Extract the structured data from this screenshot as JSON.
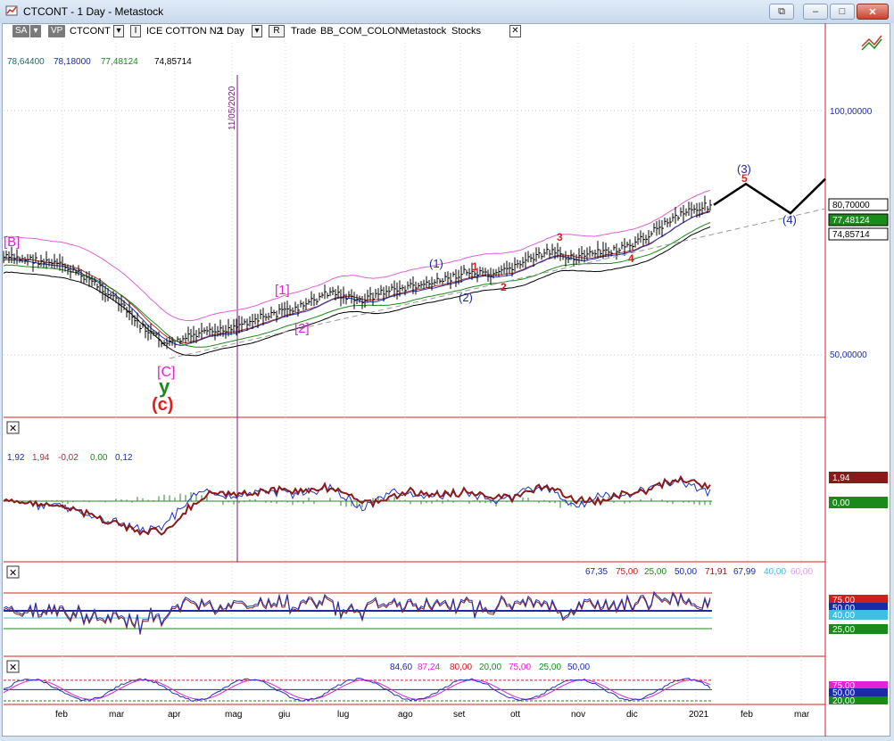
{
  "window": {
    "title": "CTCONT - 1 Day - Metastock",
    "buttons": {
      "restore_a": "⧉",
      "min": "–",
      "max": "□",
      "close": "✕"
    }
  },
  "toolbar": {
    "sa": "SA",
    "vp": "VP",
    "symbol": "CTCONT",
    "sym_dropdown": "▾",
    "i_box": "I",
    "instrument": "ICE COTTON N2",
    "period": "1 Day",
    "period_dropdown": "▾",
    "r_box": "R",
    "trade": "Trade",
    "layout": "BB_COM_COLON",
    "metastock": "Metastock",
    "stocks": "Stocks",
    "close": "✕"
  },
  "colors": {
    "price_bars": "#000000",
    "wave_magenta": "#e023d6",
    "wave_blue": "#1c2aa8",
    "wave_red": "#e02020",
    "wave_green": "#1a8a1a",
    "ma_blue": "#2233bb",
    "ma_red": "#b03030",
    "ma_green": "#1a8a1a",
    "panel_border": "#cc2020",
    "vline": "#7a1a7a"
  },
  "main_panel": {
    "header_values": [
      {
        "text": "78,64400",
        "color": "#1a6a6a"
      },
      {
        "text": "78,18000",
        "color": "#1c2aa8"
      },
      {
        "text": "77,48124",
        "color": "#1a8a1a"
      },
      {
        "text": "74,85714",
        "color": "#000000"
      }
    ],
    "y_ticks": [
      "100,00000",
      "50,00000"
    ],
    "date_marker": "11/05/2020",
    "price_labels": [
      {
        "text": "80,70000",
        "bg": "#ffffff",
        "fg": "#000000"
      },
      {
        "text": "77,48124",
        "bg": "#1a8a1a",
        "fg": "#ffffff"
      },
      {
        "text": "74,85714",
        "bg": "#ffffff",
        "fg": "#000000"
      }
    ],
    "wave_labels": [
      "[B]",
      "[C]",
      "y",
      "(c)",
      "[1]",
      "[2]",
      "(1)",
      "(2)",
      "1",
      "2",
      "3",
      "4",
      "(3)",
      "5",
      "(4)"
    ],
    "panel_close": "✕"
  },
  "macd_panel": {
    "values": [
      {
        "text": "1,92",
        "color": "#1c2aa8"
      },
      {
        "text": "1,94",
        "color": "#b03030"
      },
      {
        "text": "-0,02",
        "color": "#b03030"
      },
      {
        "text": "0,00",
        "color": "#1a8a1a"
      },
      {
        "text": "0,12",
        "color": "#1c2aa8"
      }
    ],
    "right_labels": [
      {
        "text": "1,94",
        "bg": "#8a1a1a",
        "fg": "#ffffff"
      },
      {
        "text": "0,00",
        "bg": "#1a8a1a",
        "fg": "#ffffff"
      }
    ],
    "panel_close": "✕"
  },
  "rsi_panel": {
    "values": [
      {
        "text": "67,35",
        "color": "#1c2aa8"
      },
      {
        "text": "75,00",
        "color": "#cc2020"
      },
      {
        "text": "25,00",
        "color": "#1a8a1a"
      },
      {
        "text": "50,00",
        "color": "#1c2aa8"
      },
      {
        "text": "71,91",
        "color": "#8a1a1a"
      },
      {
        "text": "67,99",
        "color": "#1c2aa8"
      },
      {
        "text": "40,00",
        "color": "#40c0e0"
      },
      {
        "text": "60,00",
        "color": "#e0a0e0"
      }
    ],
    "right_labels": [
      {
        "text": "75,00",
        "bg": "#cc2020",
        "fg": "#ffffff"
      },
      {
        "text": "50,00",
        "bg": "#1c2aa8",
        "fg": "#ffffff"
      },
      {
        "text": "40,00",
        "bg": "#40c0e0",
        "fg": "#ffffff"
      },
      {
        "text": "25,00",
        "bg": "#1a8a1a",
        "fg": "#ffffff"
      }
    ],
    "panel_close": "✕"
  },
  "stoch_panel": {
    "values": [
      {
        "text": "84,60",
        "color": "#1c2aa8"
      },
      {
        "text": "87,24",
        "color": "#e023d6"
      },
      {
        "text": "80,00",
        "color": "#cc2020"
      },
      {
        "text": "20,00",
        "color": "#1a8a1a"
      },
      {
        "text": "75,00",
        "color": "#e023d6"
      },
      {
        "text": "25,00",
        "color": "#1a8a1a"
      },
      {
        "text": "50,00",
        "color": "#1c2aa8"
      }
    ],
    "right_labels": [
      {
        "text": "75,00",
        "bg": "#e023d6",
        "fg": "#ffffff"
      },
      {
        "text": "50,00",
        "bg": "#1c2aa8",
        "fg": "#ffffff"
      },
      {
        "text": "20,00",
        "bg": "#1a8a1a",
        "fg": "#ffffff"
      }
    ],
    "panel_close": "✕"
  },
  "x_axis": {
    "months": [
      "feb",
      "mar",
      "apr",
      "mag",
      "giu",
      "lug",
      "ago",
      "set",
      "ott",
      "nov",
      "dic",
      "2021",
      "feb",
      "mar"
    ]
  },
  "chart_data": {
    "type": "candlestick-ohlc",
    "title": "CTCONT - 1 Day",
    "instrument": "ICE COTTON N2",
    "y_range_price": [
      40,
      115
    ],
    "y_ticks": [
      50,
      100
    ],
    "last_close": 80.7,
    "moving_averages": [
      78.644,
      78.18,
      77.48124,
      74.85714
    ],
    "x_months": [
      "feb",
      "mar",
      "apr",
      "mag",
      "giu",
      "lug",
      "ago",
      "set",
      "ott",
      "nov",
      "dic",
      "2021",
      "feb",
      "mar"
    ],
    "close_path": [
      [
        "gen-20",
        70
      ],
      [
        "feb-1",
        69.5
      ],
      [
        "feb-15",
        68.5
      ],
      [
        "feb-28",
        66
      ],
      [
        "mar-10",
        62
      ],
      [
        "mar-20",
        56
      ],
      [
        "apr-1",
        52
      ],
      [
        "apr-10",
        54
      ],
      [
        "apr-20",
        55
      ],
      [
        "mag-1",
        57
      ],
      [
        "mag-15",
        58.5
      ],
      [
        "giu-1",
        60
      ],
      [
        "giu-15",
        63
      ],
      [
        "lug-1",
        61
      ],
      [
        "lug-15",
        63
      ],
      [
        "ago-1",
        64
      ],
      [
        "ago-15",
        65
      ],
      [
        "set-1",
        67
      ],
      [
        "set-15",
        66
      ],
      [
        "ott-1",
        69
      ],
      [
        "ott-15",
        71
      ],
      [
        "nov-1",
        70
      ],
      [
        "nov-15",
        71
      ],
      [
        "dic-1",
        72
      ],
      [
        "dic-15",
        76
      ],
      [
        "gen-21-1",
        79.5
      ],
      [
        "gen-21-10",
        80.7
      ]
    ],
    "projection": [
      [
        "gen-21-10",
        80.7
      ],
      [
        "gen-21-25",
        85
      ],
      [
        "feb-20",
        79
      ],
      [
        "mar-15",
        86
      ]
    ],
    "macd": {
      "values": [
        1.92,
        1.94,
        -0.02,
        0.0,
        0.12
      ]
    },
    "rsi": {
      "values": [
        67.35,
        75.0,
        25.0,
        50.0,
        71.91,
        67.99,
        40.0,
        60.0
      ]
    },
    "stochastic": {
      "values": [
        84.6,
        87.24,
        80.0,
        20.0,
        75.0,
        25.0,
        50.0
      ]
    }
  }
}
